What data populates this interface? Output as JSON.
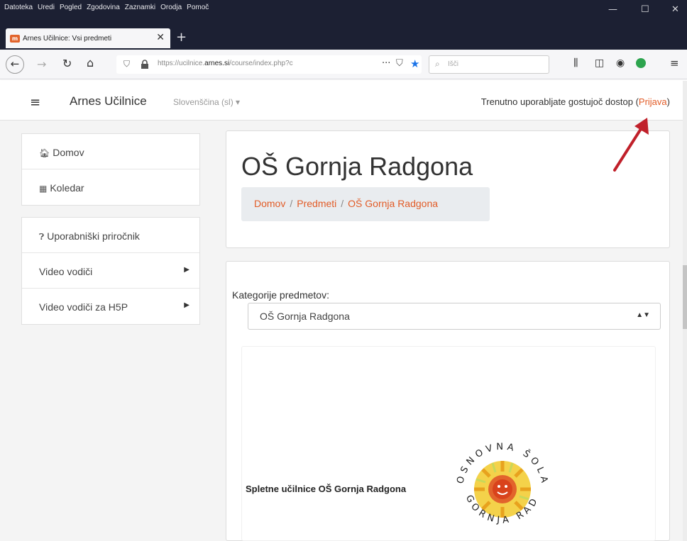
{
  "browser": {
    "menu": [
      "Datoteka",
      "Uredi",
      "Pogled",
      "Zgodovina",
      "Zaznamki",
      "Orodja",
      "Pomoč"
    ],
    "tab_title": "Arnes Učilnice: Vsi predmeti",
    "tab_close": "✕",
    "new_tab": "+",
    "url_prefix": "https://ucilnice.",
    "url_domain": "arnes.si",
    "url_path": "/course/index.php?c",
    "search_placeholder": "Išči",
    "window_controls": [
      "—",
      "☐",
      "✕"
    ]
  },
  "header": {
    "brand": "Arnes Učilnice",
    "language": "Slovenščina (sl) ▾",
    "guest_text_prefix": "Trenutno uporabljate gostujoč dostop (",
    "login_label": "Prijava",
    "guest_text_suffix": ")"
  },
  "sidebar": {
    "group1": [
      {
        "label": "Domov",
        "icon": "home-icon"
      },
      {
        "label": "Koledar",
        "icon": "calendar-icon"
      }
    ],
    "group2": [
      {
        "label": "Uporabniški priročnik",
        "icon": "help-icon"
      },
      {
        "label": "Video vodiči"
      },
      {
        "label": "Video vodiči za H5P"
      }
    ]
  },
  "main": {
    "title": "OŠ Gornja Radgona",
    "breadcrumb": [
      "Domov",
      "Predmeti",
      "OŠ Gornja Radgona"
    ],
    "category_label": "Kategorije predmetov:",
    "category_selected": "OŠ Gornja Radgona",
    "site_name": "Spletne učilnice OŠ Gornja Radgona",
    "logo_text_top": "OSNOVNA ŠOLA",
    "logo_text_bottom": "GORNJA RADGONA"
  },
  "colors": {
    "accent": "#e25b26",
    "titlebar": "#1c2033",
    "arrow": "#c0202a"
  }
}
